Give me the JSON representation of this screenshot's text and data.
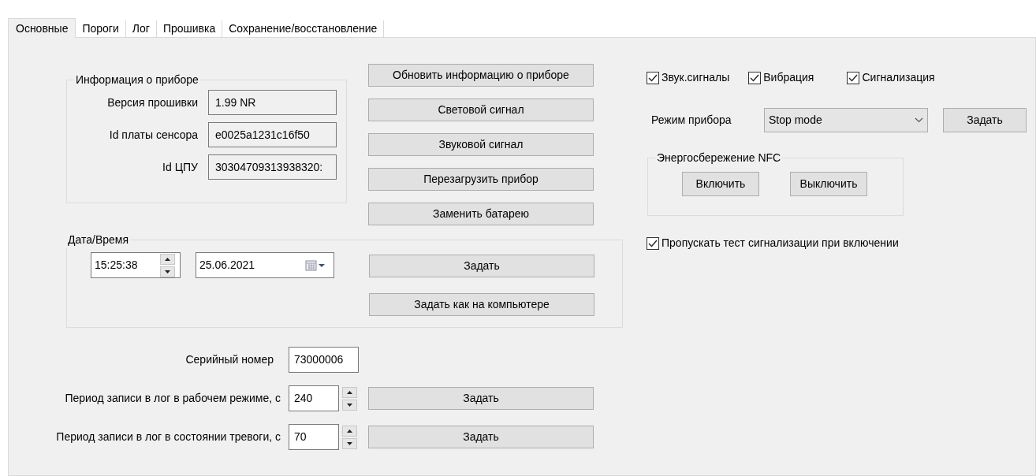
{
  "tabs": [
    {
      "label": "Основные",
      "selected": true
    },
    {
      "label": "Пороги",
      "selected": false
    },
    {
      "label": "Лог",
      "selected": false
    },
    {
      "label": "Прошивка",
      "selected": false
    },
    {
      "label": "Сохранение/восстановление",
      "selected": false
    }
  ],
  "device_info": {
    "title": "Информация о приборе",
    "fields": [
      {
        "label": "Версия прошивки",
        "value": "1.99 NR"
      },
      {
        "label": "Id платы сенсора",
        "value": "e0025a1231c16f50"
      },
      {
        "label": "Id ЦПУ",
        "value": "30304709313938320:"
      }
    ]
  },
  "device_buttons": [
    "Обновить информацию о приборе",
    "Световой сигнал",
    "Звуковой сигнал",
    "Перезагрузить прибор",
    "Заменить батарею"
  ],
  "datetime": {
    "title": "Дата/Время",
    "time": "15:25:38",
    "date": "25.06.2021",
    "buttons": [
      "Задать",
      "Задать как на компьютере"
    ]
  },
  "serial": {
    "label": "Серийный номер",
    "value": "73000006"
  },
  "log_periods": [
    {
      "label": "Период записи в лог в рабочем режиме, с",
      "value": "240",
      "button": "Задать"
    },
    {
      "label": "Период записи в лог в состоянии тревоги, с",
      "value": "70",
      "button": "Задать"
    }
  ],
  "checkboxes": [
    {
      "label": "Звук.сигналы",
      "checked": true
    },
    {
      "label": "Вибрация",
      "checked": true
    },
    {
      "label": "Сигнализация",
      "checked": true
    }
  ],
  "mode": {
    "label": "Режим прибора",
    "value": "Stop mode",
    "button": "Задать"
  },
  "nfc": {
    "title": "Энергосбережение NFC",
    "buttons": [
      "Включить",
      "Выключить"
    ]
  },
  "skip_test": {
    "label": "Пропускать тест сигнализации при включении",
    "checked": true
  }
}
